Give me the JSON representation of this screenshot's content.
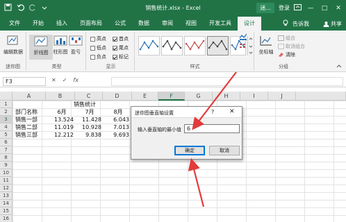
{
  "window": {
    "doc_title": "销售统计.xlsx - Excel",
    "context_label": "迷...",
    "login": "登录",
    "minimize": "—",
    "restore": "□",
    "close": "✕"
  },
  "tabs": [
    "文件",
    "开始",
    "插入",
    "页面布局",
    "公式",
    "数据",
    "审阅",
    "视图",
    "开发工具",
    "设计"
  ],
  "active_tab": "设计",
  "tell_me": "告诉我",
  "share": "共享",
  "ribbon": {
    "sparkline_group": {
      "edit_data": "编辑数据",
      "label": "迷你图"
    },
    "type_group": {
      "line": "折线图",
      "column": "柱形图",
      "winloss": "盈亏",
      "label": "类型"
    },
    "show_group": {
      "high": "高点",
      "low": "低点",
      "negative": "负点",
      "first": "首点",
      "last": "尾点",
      "markers": "标记",
      "label": "显示"
    },
    "style_group": {
      "label": "样式"
    },
    "group_group": {
      "axis": "坐标轴",
      "group": "组合",
      "ungroup": "取消组合",
      "clear": "清除",
      "label": "分组"
    }
  },
  "formula_bar": {
    "name_box": "F3",
    "cancel": "✕",
    "enter": "✓",
    "fx": "fx",
    "value": ""
  },
  "columns": [
    "A",
    "B",
    "C",
    "D",
    "E",
    "F",
    "G",
    "H",
    "I",
    "J"
  ],
  "selected_column": "F",
  "rows": [
    "1",
    "2",
    "3",
    "4",
    "5",
    "6",
    "7",
    "8",
    "9",
    "10",
    "11",
    "12",
    "13",
    "14",
    "15",
    "16"
  ],
  "selected_row": "3",
  "sheet": {
    "title": "销售统计",
    "header": [
      "部门名称",
      "6月",
      "7月",
      "8月"
    ],
    "rows": [
      [
        "销售一部",
        "13.524",
        "11.428",
        "6.043"
      ],
      [
        "销售二部",
        "11.019",
        "10.928",
        "7.013"
      ],
      [
        "销售三部",
        "12.212",
        "9.838",
        "9.693"
      ]
    ]
  },
  "dialog": {
    "title": "迷你图垂直轴设置",
    "help": "?",
    "close": "✕",
    "label": "输入垂直轴的最小值",
    "value": "6",
    "ok": "确定",
    "cancel": "取消"
  }
}
